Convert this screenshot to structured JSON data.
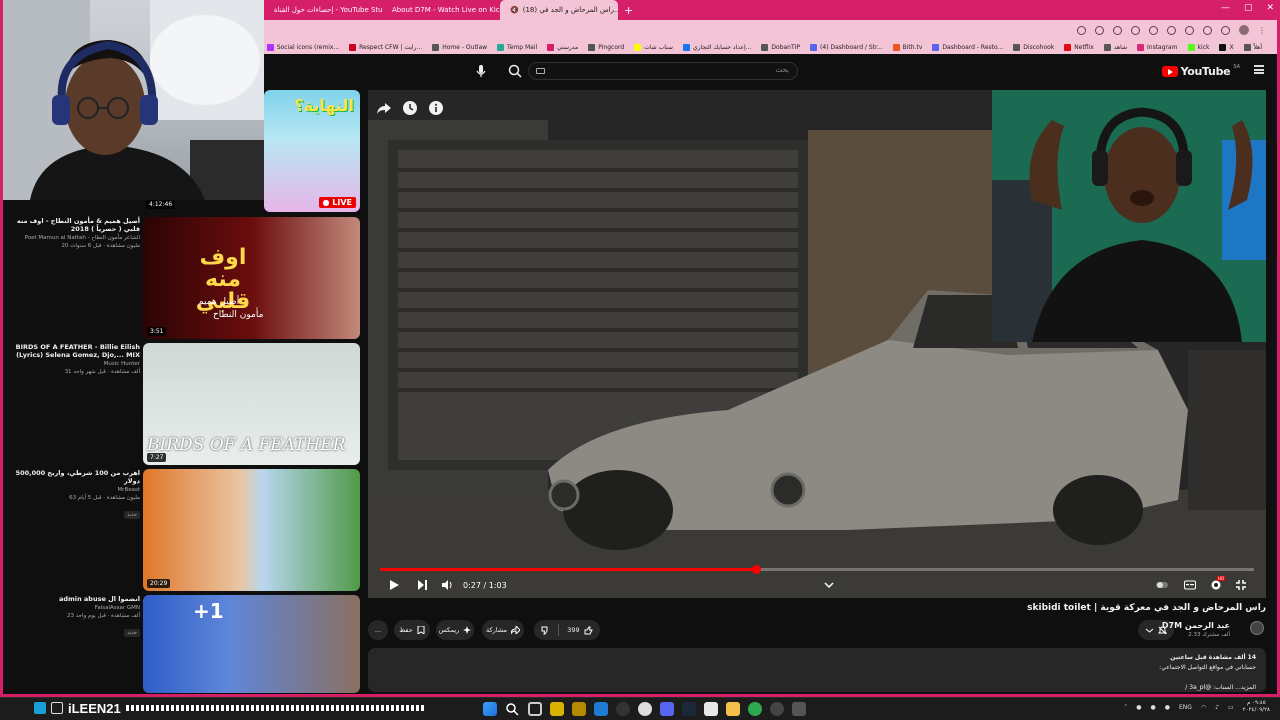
{
  "browser": {
    "tabs": [
      {
        "label": "إحصاءات حول القناة - YouTube Studio",
        "color": "#ff0033",
        "active": false
      },
      {
        "label": "About D7M - Watch Live on Kick",
        "color": "#53fc18",
        "active": false
      },
      {
        "label": "(18) راس المرحاض و الجد في...",
        "color": "#ff0033",
        "active": true
      }
    ],
    "bookmarks": [
      "أهلاً",
      "X",
      "kick",
      "Instagram",
      "شاهد",
      "Netflix",
      "Discohook",
      "Dashboard - Resto...",
      "Bith.tv",
      "(4) Dashboard / Str...",
      "DobanTIP",
      "إعداد حسابك التجاري...",
      "سناب شات",
      "Pingcord",
      "مدرستي",
      "Temp Mail",
      "Home - Outlaw",
      "Respect CFW | رايت...",
      "Social icons (remix..."
    ]
  },
  "youtube": {
    "logo_text": "YouTube",
    "region": "SA",
    "search_placeholder": "بحث"
  },
  "sidebar": {
    "items": [
      {
        "duration": "4:12:46",
        "live_label": "LIVE",
        "thumb_text": "النهاية؟",
        "title": "",
        "channel": "",
        "stats": ""
      },
      {
        "duration": "3:51",
        "thumb_text": "اوف منه قلبي",
        "thumb_sub": "أصيل هميم",
        "thumb_sub2": "مأمون النطاح",
        "title": "أصيل هميم & مأمون النطاح - اوف منه قلبي ( حصرياً ) 2018",
        "channel": "Poet Mamun al Nattah - الشاعر مأمون النطاح",
        "stats": "20 مليون مشاهدة · قبل 6 سنوات"
      },
      {
        "duration": "7:27",
        "thumb_text": "BIRDS OF A FEATHER",
        "title": "BIRDS OF A FEATHER - Billie Eilish (Lyrics) Selena Gomez, Djo,... MIX",
        "channel": "Music Hunter",
        "stats": "31 ألف مشاهدة · قبل شهر واحد"
      },
      {
        "duration": "20:29",
        "title": "اهرب من 100 شرطي، واربح 500,000 دولار",
        "channel": "MrBeast",
        "stats": "63 مليون مشاهدة · قبل 5 أيام",
        "badge": "جديد"
      },
      {
        "duration": "",
        "thumb_text": "+1",
        "title": "admin abuse انضموا ال",
        "channel": "FaisalAssar GMN",
        "stats": "23 ألف مشاهدة · قبل يوم واحد",
        "badge": "جديد"
      }
    ]
  },
  "player": {
    "current_time": "0:27",
    "duration": "1:03",
    "time_separator": "/",
    "progress": 0.43,
    "hd_badge": "HD"
  },
  "video": {
    "title": "راس المرحاض و الجد في معركة قوية | skibidi toilet",
    "channel_name": "D7M عبد الرحمن",
    "channel_subs": "2.33 ألف مشترك",
    "like_count": "399",
    "share_label": "مشاركة",
    "remix_label": "ريمكس",
    "save_label": "حفظ",
    "more_label": "...",
    "desc_line1": "14 ألف مشاهدة  قبل ساعتين",
    "desc_line2": "حساباتي في مواقع التواصل الاجتماعي:",
    "desc_line3": "المزيد... السناب: @3a_pl /"
  },
  "taskbar": {
    "streamer_name": "iLEEN21",
    "lang": "ENG",
    "time": "٠٩:٤٥ م",
    "date": "٢٠٢٤/٠٩/٢٨"
  }
}
